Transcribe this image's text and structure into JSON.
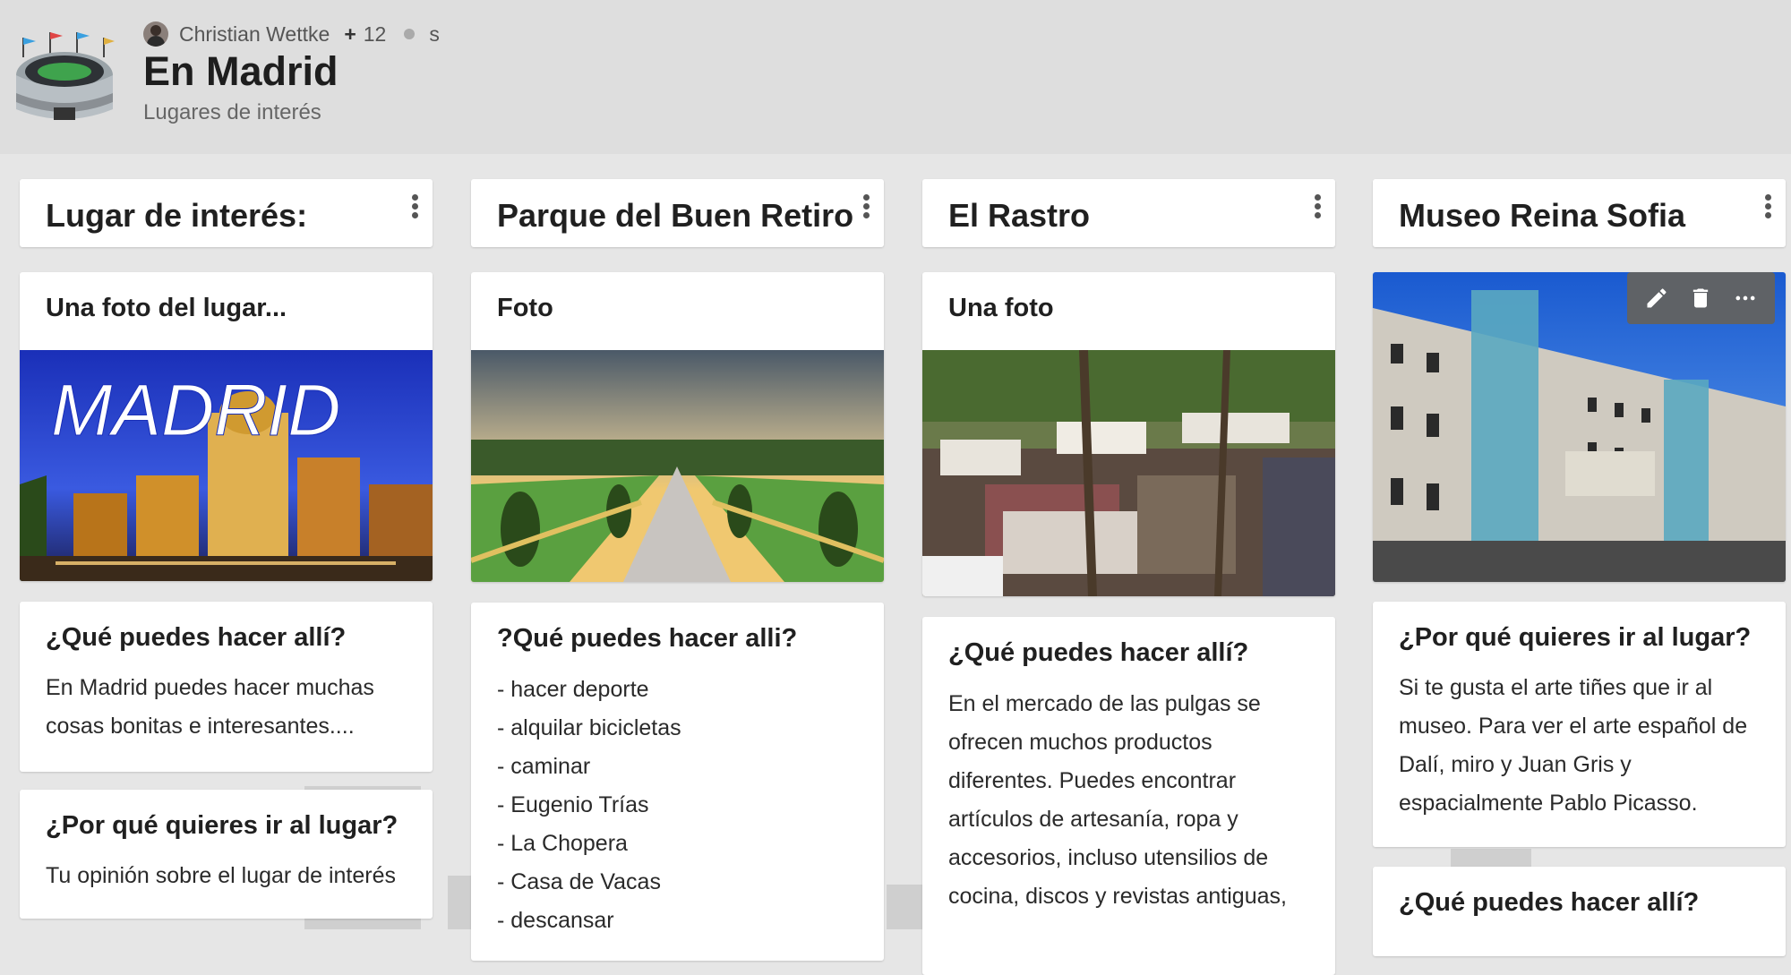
{
  "header": {
    "author": "Christian Wettke",
    "plus": "+",
    "count": "12",
    "extra": "s",
    "title": "En Madrid",
    "subtitle": "Lugares de interés"
  },
  "columns": [
    {
      "title": "Lugar de interés:",
      "cards": [
        {
          "title": "Una foto del lugar...",
          "photo_label": "MADRID"
        },
        {
          "title": "¿Qué puedes hacer allí?",
          "lines": [
            "En Madrid puedes hacer muchas",
            "cosas bonitas e interesantes...."
          ]
        },
        {
          "title": "¿Por qué quieres ir al lugar?",
          "lines": [
            "Tu opinión sobre el lugar de interés"
          ]
        }
      ]
    },
    {
      "title": "Parque del Buen Retiro",
      "cards": [
        {
          "title": "Foto"
        },
        {
          "title": "?Qué puedes hacer alli?",
          "lines": [
            "- hacer deporte",
            "- alquilar bicicletas",
            "- caminar",
            "- Eugenio Trías",
            "- La Chopera",
            "- Casa de Vacas",
            "- descansar"
          ]
        }
      ]
    },
    {
      "title": "El Rastro",
      "cards": [
        {
          "title": "Una foto"
        },
        {
          "title": "¿Qué puedes hacer allí?",
          "lines": [
            "En el mercado de las pulgas se",
            "ofrecen muchos productos",
            "diferentes. Puedes encontrar",
            "artículos de artesanía, ropa y",
            "accesorios, incluso utensilios de",
            "cocina, discos y revistas antiguas,"
          ]
        }
      ]
    },
    {
      "title": "Museo Reina Sofia",
      "cards": [
        {
          "title": "",
          "tools": [
            "pencil-icon",
            "trash-icon",
            "more-horizontal-icon"
          ]
        },
        {
          "title": "¿Por qué quieres ir al lugar?",
          "lines": [
            "Si te gusta el arte tiñes que ir al",
            "museo. Para ver el arte español de",
            "Dalí, miro y Juan Gris y",
            "espacialmente Pablo Picasso."
          ]
        },
        {
          "title": "¿Qué puedes hacer allí?"
        }
      ]
    }
  ],
  "colors": {
    "background": "#e6e6e6",
    "header": "#dedede",
    "card": "#ffffff",
    "toolbar": "#5f6266"
  }
}
